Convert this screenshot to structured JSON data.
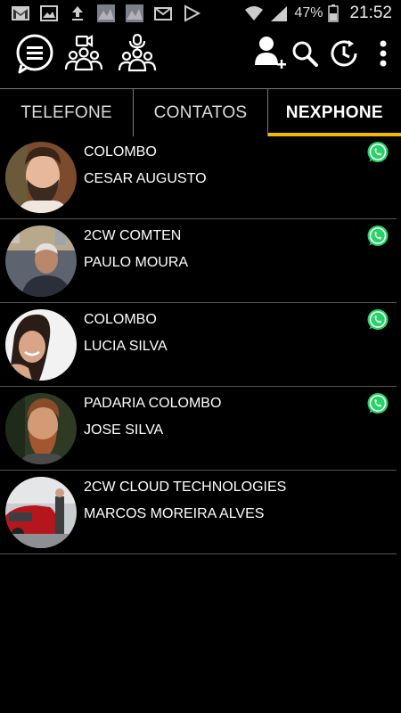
{
  "status_bar": {
    "battery_percent": "47%",
    "time": "21:52"
  },
  "tabs": [
    {
      "label": "TELEFONE",
      "active": false
    },
    {
      "label": "CONTATOS",
      "active": false
    },
    {
      "label": "NEXPHONE",
      "active": true
    }
  ],
  "colors": {
    "accent": "#f5b800",
    "whatsapp": "#25d366"
  },
  "contacts": [
    {
      "company": "COLOMBO",
      "name": "CESAR AUGUSTO",
      "whatsapp": true
    },
    {
      "company": "2CW COMTEN",
      "name": "PAULO MOURA",
      "whatsapp": true
    },
    {
      "company": "COLOMBO",
      "name": "LUCIA SILVA",
      "whatsapp": true
    },
    {
      "company": "PADARIA COLOMBO",
      "name": "JOSE SILVA",
      "whatsapp": true
    },
    {
      "company": "2CW CLOUD TECHNOLOGIES",
      "name": "MARCOS MOREIRA ALVES",
      "whatsapp": false
    }
  ]
}
